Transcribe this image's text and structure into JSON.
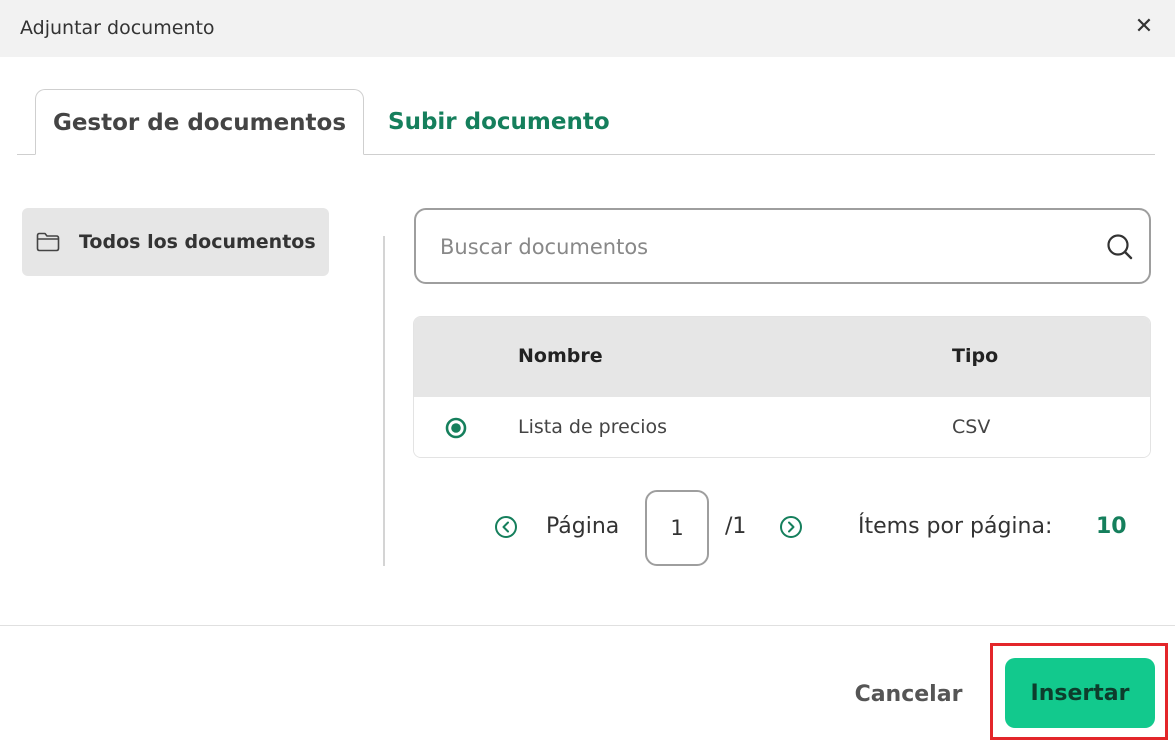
{
  "dialog": {
    "title": "Adjuntar documento",
    "close_glyph": "✕"
  },
  "tabs": [
    {
      "label": "Gestor de documentos",
      "active": true
    },
    {
      "label": "Subir documento",
      "active": false
    }
  ],
  "sidebar": {
    "folder": {
      "label": "Todos los documentos",
      "icon": "folder-icon"
    }
  },
  "search": {
    "placeholder": "Buscar documentos",
    "value": "",
    "icon": "search-icon"
  },
  "table": {
    "columns": [
      "Nombre",
      "Tipo"
    ],
    "rows": [
      {
        "name": "Lista de precios",
        "type": "CSV",
        "selected": true
      }
    ]
  },
  "pagination": {
    "page_label": "Página",
    "current_page": "1",
    "total": "/1",
    "per_page_label": "Ítems por página:",
    "per_page_value": "10"
  },
  "footer": {
    "cancel_label": "Cancelar",
    "insert_label": "Insertar"
  },
  "colors": {
    "accent": "#157f5c",
    "primary_button": "#12c98d",
    "highlight": "#e3262a",
    "header_bg": "#f2f2f2"
  }
}
